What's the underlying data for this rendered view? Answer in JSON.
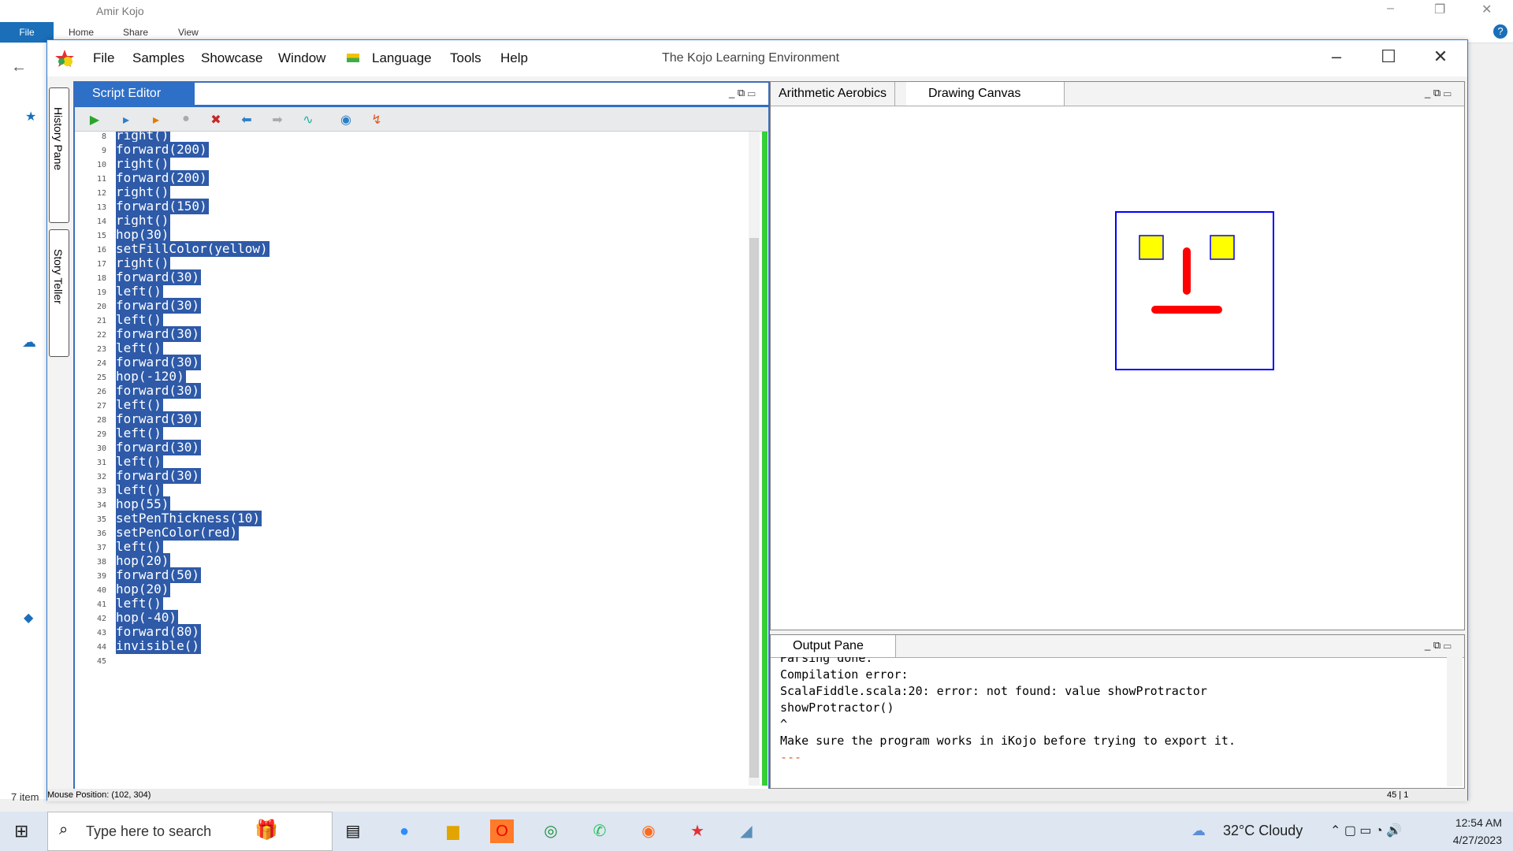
{
  "explorer": {
    "title": "Amir Kojo",
    "ribbon_file": "File",
    "ribbon_tabs": [
      "Home",
      "Share",
      "View"
    ],
    "status": "7 item"
  },
  "kojo": {
    "menus": [
      "File",
      "Samples",
      "Showcase",
      "Window",
      "Language",
      "Tools",
      "Help"
    ],
    "title": "The Kojo Learning Environment",
    "side_tabs": [
      "History Pane",
      "Story Teller"
    ],
    "script_editor": {
      "tab": "Script Editor",
      "lines": [
        {
          "n": "8",
          "code": "right()"
        },
        {
          "n": "9",
          "code": "forward(200)"
        },
        {
          "n": "10",
          "code": "right()"
        },
        {
          "n": "11",
          "code": "forward(200)"
        },
        {
          "n": "12",
          "code": "right()"
        },
        {
          "n": "13",
          "code": "forward(150)"
        },
        {
          "n": "14",
          "code": "right()"
        },
        {
          "n": "15",
          "code": "hop(30)"
        },
        {
          "n": "16",
          "code": "setFillColor(yellow)"
        },
        {
          "n": "17",
          "code": "right()"
        },
        {
          "n": "18",
          "code": "forward(30)"
        },
        {
          "n": "19",
          "code": "left()"
        },
        {
          "n": "20",
          "code": "forward(30)"
        },
        {
          "n": "21",
          "code": "left()"
        },
        {
          "n": "22",
          "code": "forward(30)"
        },
        {
          "n": "23",
          "code": "left()"
        },
        {
          "n": "24",
          "code": "forward(30)"
        },
        {
          "n": "25",
          "code": "hop(-120)"
        },
        {
          "n": "26",
          "code": "forward(30)"
        },
        {
          "n": "27",
          "code": "left()"
        },
        {
          "n": "28",
          "code": "forward(30)"
        },
        {
          "n": "29",
          "code": "left()"
        },
        {
          "n": "30",
          "code": "forward(30)"
        },
        {
          "n": "31",
          "code": "left()"
        },
        {
          "n": "32",
          "code": "forward(30)"
        },
        {
          "n": "33",
          "code": "left()"
        },
        {
          "n": "34",
          "code": "hop(55)"
        },
        {
          "n": "35",
          "code": "setPenThickness(10)"
        },
        {
          "n": "36",
          "code": "setPenColor(red)"
        },
        {
          "n": "37",
          "code": "left()"
        },
        {
          "n": "38",
          "code": "hop(20)"
        },
        {
          "n": "39",
          "code": "forward(50)"
        },
        {
          "n": "40",
          "code": "hop(20)"
        },
        {
          "n": "41",
          "code": "left()"
        },
        {
          "n": "42",
          "code": "hop(-40)"
        },
        {
          "n": "43",
          "code": "forward(80)"
        },
        {
          "n": "44",
          "code": "invisible()"
        },
        {
          "n": "45",
          "code": ""
        }
      ]
    },
    "canvas_tabs": [
      "Arithmetic Aerobics",
      "Drawing Canvas"
    ],
    "output": {
      "tab": "Output Pane",
      "lines": [
        "Parsing done.",
        "Compilation error:",
        "ScalaFiddle.scala:20: error: not found: value showProtractor",
        "showProtractor()",
        "^",
        "Make sure the program works in iKojo before trying to export it.",
        "---"
      ]
    },
    "status_mouse": "Mouse Position: (102, 304)",
    "status_cursor": "45 | 1",
    "colors": {
      "face_border": "#0000ff",
      "eyes": "#ffff00",
      "mouth": "#ff0000",
      "selection": "#2e5aa8",
      "run_bar": "#34d036"
    }
  },
  "taskbar": {
    "search_placeholder": "Type here to search",
    "weather": "32°C  Cloudy",
    "time": "12:54 AM",
    "date": "4/27/2023"
  }
}
